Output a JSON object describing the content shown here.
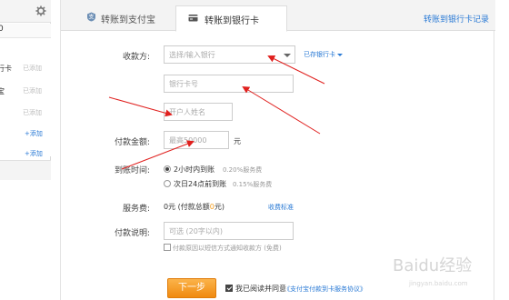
{
  "sidebar": {
    "top_row": "0",
    "items": [
      {
        "name": "行卡",
        "status": "已添加"
      },
      {
        "name": "宝",
        "status": "已添加"
      },
      {
        "name": "",
        "status": "已添加"
      },
      {
        "name": "",
        "action": "+添加"
      },
      {
        "name": "",
        "action": "+添加"
      }
    ]
  },
  "tabs": [
    {
      "label": "转账到支付宝",
      "icon": "alipay-icon",
      "active": false
    },
    {
      "label": "转账到银行卡",
      "icon": "bank-card-icon",
      "active": true
    }
  ],
  "record_link": "转账到银行卡记录",
  "form": {
    "payee_label": "收款方:",
    "bank_select_placeholder": "选择/输入银行",
    "saved_cards_link": "已存银行卡",
    "card_number_placeholder": "银行卡号",
    "account_name_placeholder": "开户人姓名",
    "amount_label": "付款金额:",
    "amount_placeholder": "最高50000",
    "amount_unit": "元",
    "arrival_label": "到账时间:",
    "arrival_options": [
      {
        "label": "2小时内到账",
        "fee": "0.20%服务费",
        "selected": true
      },
      {
        "label": "次日24点前到账",
        "fee": "0.15%服务费",
        "selected": false
      }
    ],
    "service_fee_label": "服务费:",
    "service_fee_prefix": "0元 (付款总额",
    "service_fee_amount": "0",
    "service_fee_suffix": "元)",
    "fee_standard_link": "收费标准",
    "note_label": "付款说明:",
    "note_placeholder": "可选 (20字以内)",
    "notify_text": "付款原因以短信方式通知收款方 (免费)",
    "notify_checked": false,
    "next_button": "下一步",
    "agree_text": "我已阅读并同意",
    "agreement_link": "《支付宝付款到卡服务协议》",
    "agree_checked": true
  },
  "watermark": {
    "text": "Baidu经验",
    "sub": "jingyan.baidu.com"
  },
  "colors": {
    "accent": "#2a7ad5",
    "button": "#f39c1b",
    "arrow": "#e0201e"
  }
}
